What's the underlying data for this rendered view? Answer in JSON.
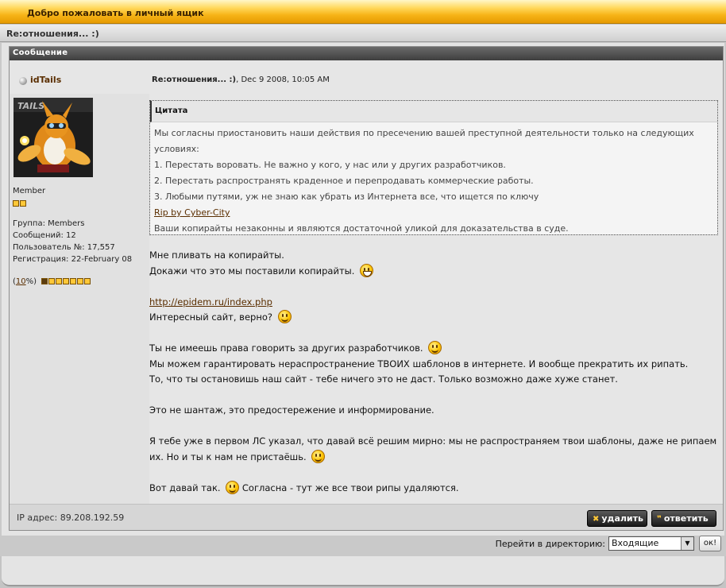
{
  "header": {
    "title": "Добро пожаловать в личный ящик"
  },
  "thread": {
    "title": "Re:отношения... :)"
  },
  "post": {
    "section_label": "Сообщение",
    "author": "idTails",
    "subject": "Re:отношения... :)",
    "date": ", Dec 9 2008, 10:05 AM",
    "author_info": {
      "title": "Member",
      "group": "Группа: Members",
      "posts": "Сообщений: 12",
      "member_no": "Пользователь №: 17,557",
      "registered": "Регистрация: 22-February 08",
      "rep_prefix": "(",
      "rep_value": "10",
      "rep_suffix": "%)",
      "rep_percent": 10
    },
    "quote": {
      "label": "Цитата",
      "lines": [
        "Мы согласны приостановить наши действия по пресечению вашей преступной деятельности только на следующих условиях:",
        "1. Перестать воровать. Не важно у кого, у нас или у других разработчиков.",
        "2. Перестать распространять краденное и перепродавать коммерческие работы.",
        "3. Любыми путями, уж не знаю как убрать из Интернета все, что ищется по ключу"
      ],
      "link": "Rip by Cyber-City",
      "last_line": "Ваши копирайты незаконны и являются достаточной уликой для доказательства в суде."
    },
    "message": {
      "l1": "Мне пливать на копирайты.",
      "l2": "Докажи что это мы поставили копирайты.",
      "link": "http://epidem.ru/index.php",
      "l3": "Интересный сайт, верно?",
      "l4": "Ты не имеешь права говорить за других разработчиков.",
      "l5": "Мы можем гарантировать нераспространение ТВОИХ шаблонов в интернете. И вообще прекратить их рипать.",
      "l6": "То, что ты остановишь наш сайт - тебе ничего это не даст. Только возможно даже хуже станет.",
      "l7": "Это не шантаж, это предостережение и информирование.",
      "l8": "Я тебе уже в первом ЛС указал, что давай всё решим мирно: мы не распространяем твои шаблоны, даже не рипаем их. Но и ты к нам не пристаёшь.",
      "l9a": "Вот давай так.",
      "l9b": "Согласна - тут же все твои рипы удаляются."
    },
    "ip": "IP адрес: 89.208.192.59",
    "delete_label": "удалить",
    "reply_label": "ответить"
  },
  "jump": {
    "label": "Перейти в директорию:",
    "selected": "Входящие",
    "go_label": "ок!"
  }
}
